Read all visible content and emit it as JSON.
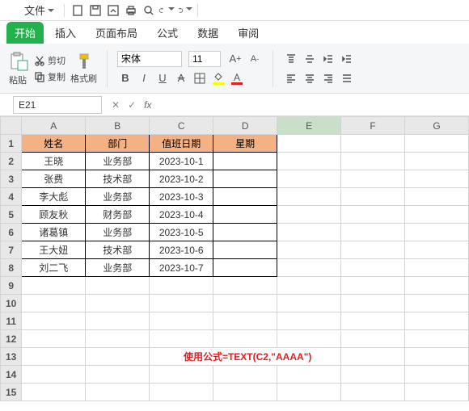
{
  "menu": {
    "file": "文件"
  },
  "tabs": {
    "start": "开始",
    "insert": "插入",
    "layout": "页面布局",
    "formula": "公式",
    "data": "数据",
    "review": "审阅"
  },
  "ribbon": {
    "paste": "粘贴",
    "cut": "剪切",
    "copy": "复制",
    "format_painter": "格式刷",
    "font_name": "宋体",
    "font_size": "11"
  },
  "namebox": {
    "value": "E21"
  },
  "columns": [
    "A",
    "B",
    "C",
    "D",
    "E",
    "F",
    "G"
  ],
  "headers": {
    "A": "姓名",
    "B": "部门",
    "C": "值班日期",
    "D": "星期"
  },
  "rows": [
    {
      "A": "王晓",
      "B": "业务部",
      "C": "2023-10-1",
      "D": ""
    },
    {
      "A": "张费",
      "B": "技术部",
      "C": "2023-10-2",
      "D": ""
    },
    {
      "A": "李大彪",
      "B": "业务部",
      "C": "2023-10-3",
      "D": ""
    },
    {
      "A": "顾友秋",
      "B": "财务部",
      "C": "2023-10-4",
      "D": ""
    },
    {
      "A": "诸葛镇",
      "B": "业务部",
      "C": "2023-10-5",
      "D": ""
    },
    {
      "A": "王大妞",
      "B": "技术部",
      "C": "2023-10-6",
      "D": ""
    },
    {
      "A": "刘二飞",
      "B": "业务部",
      "C": "2023-10-7",
      "D": ""
    }
  ],
  "annotation": "使用公式=TEXT(C2,\"AAAA\")",
  "total_rows": 15,
  "selected_col": "E",
  "colors": {
    "header_fill": "#f4b183",
    "accent": "#22b14c",
    "annotation": "#e02020"
  }
}
